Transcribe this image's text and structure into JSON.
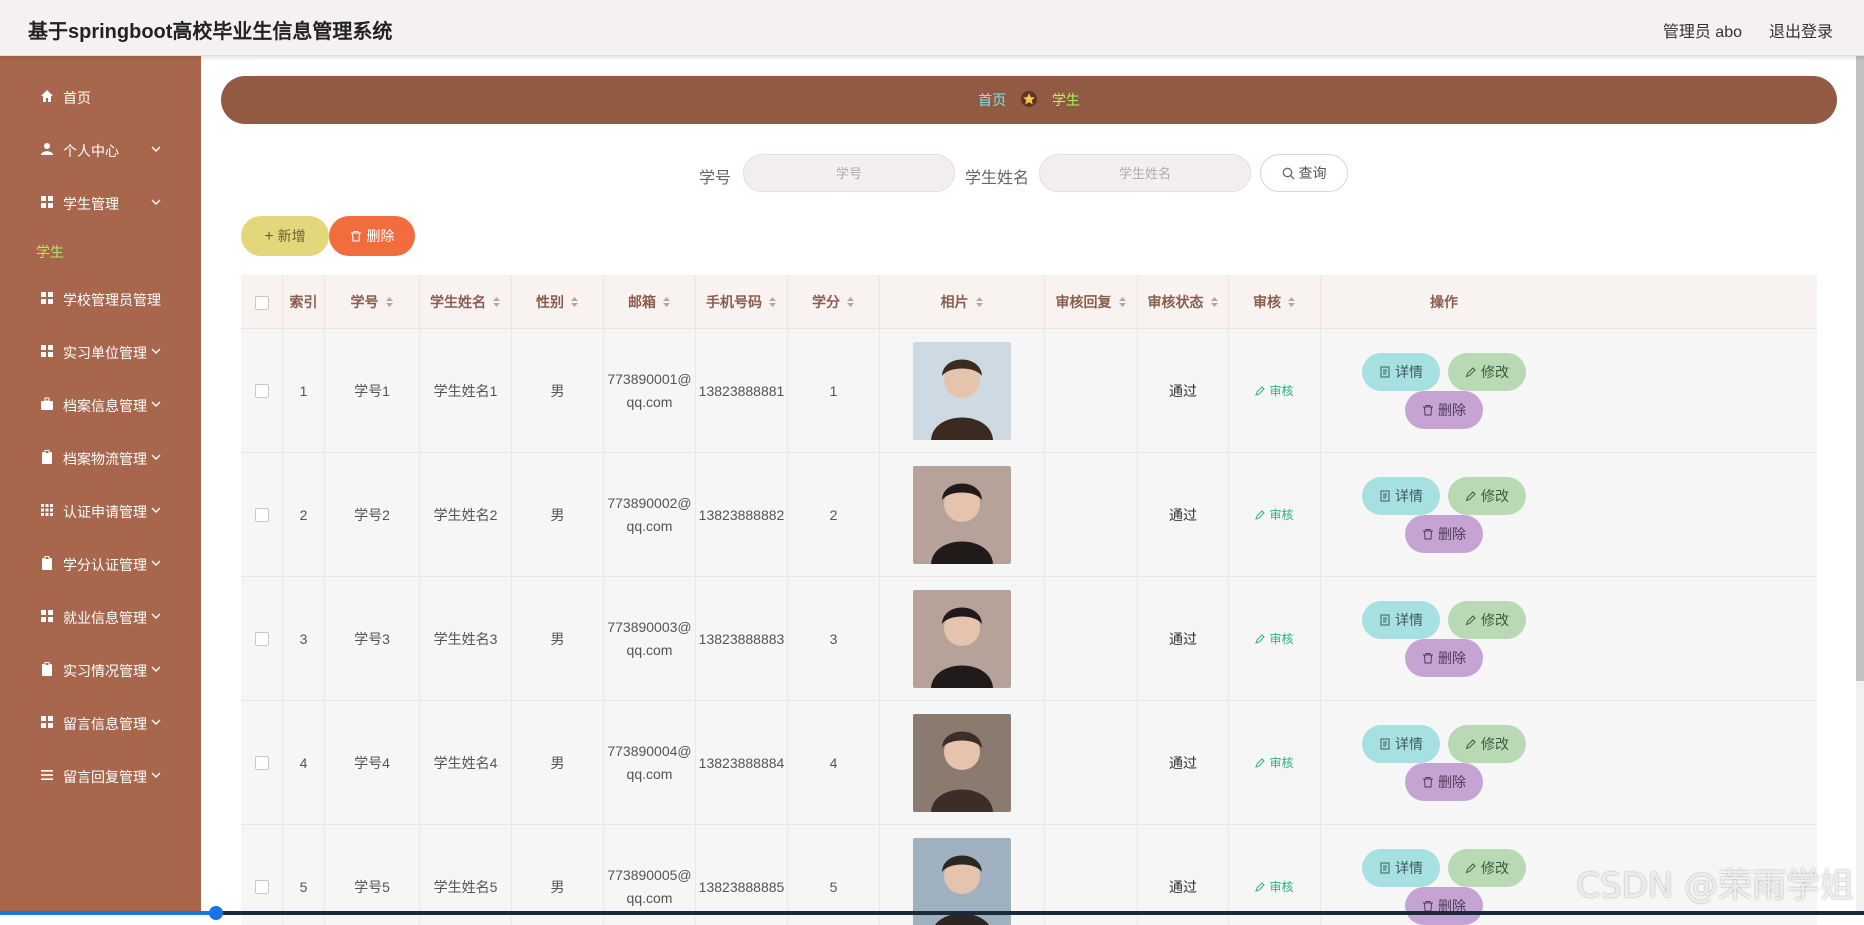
{
  "header": {
    "title": "基于springboot高校毕业生信息管理系统",
    "user": "管理员 abo",
    "logout": "退出登录"
  },
  "sidebar": {
    "items": [
      {
        "label": "首页",
        "icon": "home-icon",
        "has_arrow": false
      },
      {
        "label": "个人中心",
        "icon": "user-icon",
        "has_arrow": true
      },
      {
        "label": "学生管理",
        "icon": "grid-icon",
        "has_arrow": true
      },
      {
        "label": "学校管理员管理",
        "icon": "grid-icon",
        "has_arrow": false
      },
      {
        "label": "实习单位管理",
        "icon": "grid-icon",
        "has_arrow": true
      },
      {
        "label": "档案信息管理",
        "icon": "briefcase-icon",
        "has_arrow": true
      },
      {
        "label": "档案物流管理",
        "icon": "clipboard-icon",
        "has_arrow": true
      },
      {
        "label": "认证申请管理",
        "icon": "apps-icon",
        "has_arrow": true
      },
      {
        "label": "学分认证管理",
        "icon": "clipboard-icon",
        "has_arrow": true
      },
      {
        "label": "就业信息管理",
        "icon": "grid-icon",
        "has_arrow": true
      },
      {
        "label": "实习情况管理",
        "icon": "clipboard-icon",
        "has_arrow": true
      },
      {
        "label": "留言信息管理",
        "icon": "grid-icon",
        "has_arrow": true
      },
      {
        "label": "留言回复管理",
        "icon": "list-icon",
        "has_arrow": true
      }
    ],
    "sub_item": "学生"
  },
  "breadcrumb": {
    "home": "首页",
    "current": "学生"
  },
  "search": {
    "field1_label": "学号",
    "field1_placeholder": "学号",
    "field2_label": "学生姓名",
    "field2_placeholder": "学生姓名",
    "query_label": "查询"
  },
  "actions": {
    "add_label": "新增",
    "delete_label": "删除"
  },
  "table": {
    "headers": [
      "索引",
      "学号",
      "学生姓名",
      "性别",
      "邮箱",
      "手机号码",
      "学分",
      "相片",
      "审核回复",
      "审核状态",
      "审核",
      "操作"
    ],
    "row_actions": {
      "detail": "详情",
      "edit": "修改",
      "remove": "删除"
    },
    "audit_link": "审核",
    "rows": [
      {
        "index": "1",
        "student_no": "学号1",
        "name": "学生姓名1",
        "gender": "男",
        "email_a": "773890001@",
        "email_b": "qq.com",
        "phone": "13823888881",
        "credit": "1",
        "reply": "",
        "status": "通过"
      },
      {
        "index": "2",
        "student_no": "学号2",
        "name": "学生姓名2",
        "gender": "男",
        "email_a": "773890002@",
        "email_b": "qq.com",
        "phone": "13823888882",
        "credit": "2",
        "reply": "",
        "status": "通过"
      },
      {
        "index": "3",
        "student_no": "学号3",
        "name": "学生姓名3",
        "gender": "男",
        "email_a": "773890003@",
        "email_b": "qq.com",
        "phone": "13823888883",
        "credit": "3",
        "reply": "",
        "status": "通过"
      },
      {
        "index": "4",
        "student_no": "学号4",
        "name": "学生姓名4",
        "gender": "男",
        "email_a": "773890004@",
        "email_b": "qq.com",
        "phone": "13823888884",
        "credit": "4",
        "reply": "",
        "status": "通过"
      },
      {
        "index": "5",
        "student_no": "学号5",
        "name": "学生姓名5",
        "gender": "男",
        "email_a": "773890005@",
        "email_b": "qq.com",
        "phone": "13823888885",
        "credit": "5",
        "reply": "",
        "status": "通过"
      }
    ]
  },
  "watermark": "CSDN @荣雨学姐",
  "colors": {
    "sidebar": "#a8674d",
    "breadcrumb": "#935a43",
    "add": "#e2d77b",
    "delete": "#f26d3d"
  }
}
